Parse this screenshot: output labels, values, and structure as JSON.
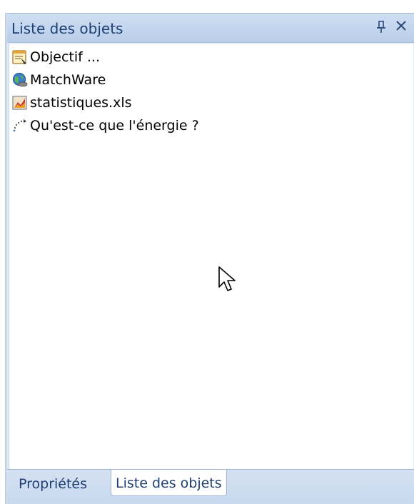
{
  "panel": {
    "title": "Liste des objets",
    "pin_glyph": "ᵽ",
    "close_glyph": "✕"
  },
  "objects": [
    {
      "label": "Objectif ...",
      "icon": "objective-icon"
    },
    {
      "label": "MatchWare",
      "icon": "web-globe-icon"
    },
    {
      "label": "statistiques.xls",
      "icon": "spreadsheet-icon"
    },
    {
      "label": "Qu'est-ce que l'énergie ?",
      "icon": "path-animation-icon"
    }
  ],
  "tabs": [
    {
      "label": "Propriétés",
      "active": false
    },
    {
      "label": "Liste des objets",
      "active": true
    }
  ],
  "colors": {
    "title_text": "#1e3f74",
    "panel_bg": "#dfe9f5",
    "title_bar": "#c2d5ee"
  }
}
